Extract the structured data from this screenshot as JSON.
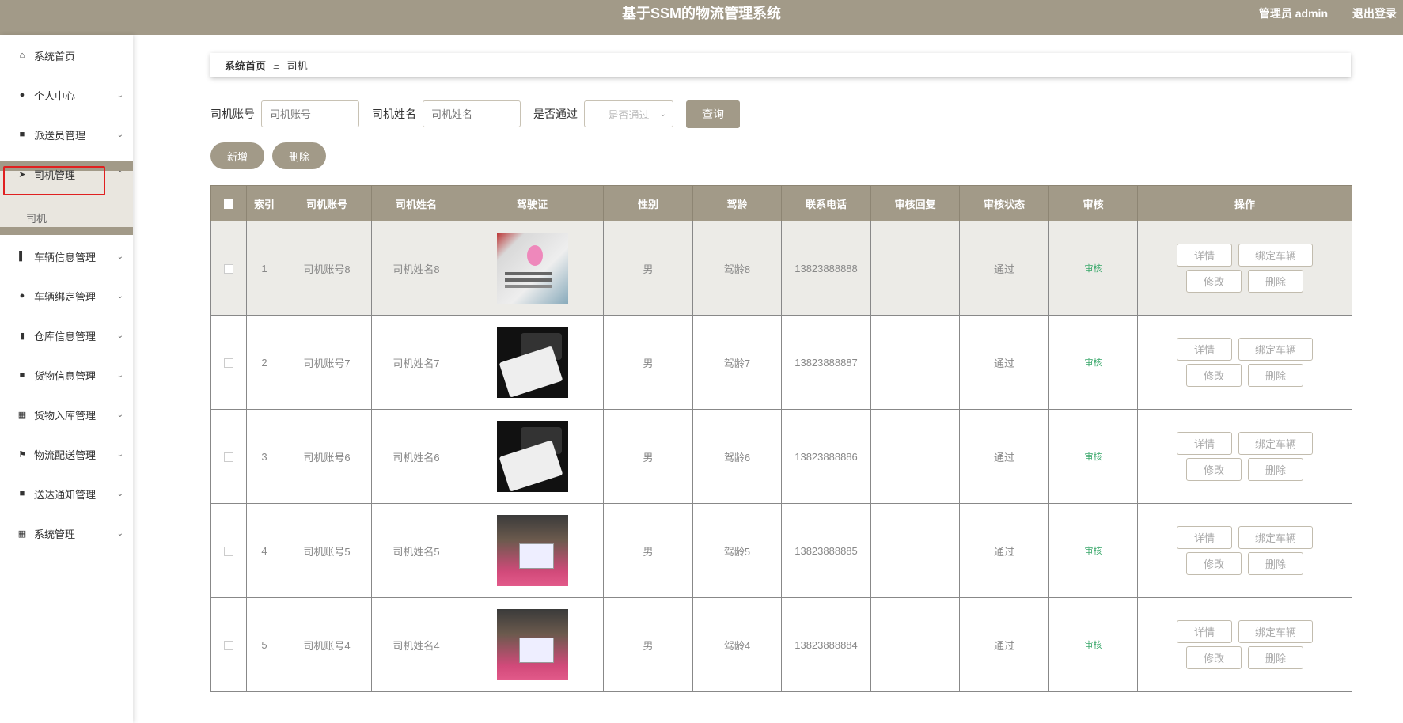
{
  "header": {
    "title": "基于SSM的物流管理系统",
    "user": "管理员 admin",
    "logout": "退出登录"
  },
  "sidebar": {
    "items": [
      {
        "label": "系统首页",
        "icon": "home-icon",
        "glyph": "⌂",
        "chevron": ""
      },
      {
        "label": "个人中心",
        "icon": "user-icon",
        "glyph": "●",
        "chevron": "⌄"
      },
      {
        "label": "派送员管理",
        "icon": "briefcase-icon",
        "glyph": "■",
        "chevron": "⌄"
      },
      {
        "label": "司机管理",
        "icon": "send-icon",
        "glyph": "➤",
        "chevron": "⌃"
      },
      {
        "label": "车辆信息管理",
        "icon": "chart-icon",
        "glyph": "▌",
        "chevron": "⌄"
      },
      {
        "label": "车辆绑定管理",
        "icon": "bulb-icon",
        "glyph": "●",
        "chevron": "⌄"
      },
      {
        "label": "仓库信息管理",
        "icon": "bar-chart-icon",
        "glyph": "▮",
        "chevron": "⌄"
      },
      {
        "label": "货物信息管理",
        "icon": "trash-icon",
        "glyph": "■",
        "chevron": "⌄"
      },
      {
        "label": "货物入库管理",
        "icon": "grid-icon",
        "glyph": "▦",
        "chevron": "⌄"
      },
      {
        "label": "物流配送管理",
        "icon": "flag-icon",
        "glyph": "⚑",
        "chevron": "⌄"
      },
      {
        "label": "送达通知管理",
        "icon": "clipboard-icon",
        "glyph": "■",
        "chevron": "⌄"
      },
      {
        "label": "系统管理",
        "icon": "grid-icon",
        "glyph": "▦",
        "chevron": "⌄"
      }
    ],
    "submenu": "司机"
  },
  "breadcrumb": {
    "home": "系统首页",
    "sep": "Ξ",
    "current": "司机"
  },
  "search": {
    "account_label": "司机账号",
    "account_placeholder": "司机账号",
    "name_label": "司机姓名",
    "name_placeholder": "司机姓名",
    "pass_label": "是否通过",
    "pass_placeholder": "是否通过",
    "query": "查询"
  },
  "actions": {
    "add": "新增",
    "delete": "删除"
  },
  "table": {
    "headers": [
      "索引",
      "司机账号",
      "司机姓名",
      "驾驶证",
      "性别",
      "驾龄",
      "联系电话",
      "审核回复",
      "审核状态",
      "审核",
      "操作"
    ],
    "rows": [
      {
        "index": "1",
        "account": "司机账号8",
        "name": "司机姓名8",
        "photo": "license-photo",
        "gender": "男",
        "years": "驾龄8",
        "phone": "13823888888",
        "reply": "",
        "status": "通过",
        "audit": "审核"
      },
      {
        "index": "2",
        "account": "司机账号7",
        "name": "司机姓名7",
        "photo": "license-photo",
        "gender": "男",
        "years": "驾龄7",
        "phone": "13823888887",
        "reply": "",
        "status": "通过",
        "audit": "审核"
      },
      {
        "index": "3",
        "account": "司机账号6",
        "name": "司机姓名6",
        "photo": "license-photo",
        "gender": "男",
        "years": "驾龄6",
        "phone": "13823888886",
        "reply": "",
        "status": "通过",
        "audit": "审核"
      },
      {
        "index": "4",
        "account": "司机账号5",
        "name": "司机姓名5",
        "photo": "license-photo",
        "gender": "男",
        "years": "驾龄5",
        "phone": "13823888885",
        "reply": "",
        "status": "通过",
        "audit": "审核"
      },
      {
        "index": "5",
        "account": "司机账号4",
        "name": "司机姓名4",
        "photo": "license-photo",
        "gender": "男",
        "years": "驾龄4",
        "phone": "13823888884",
        "reply": "",
        "status": "通过",
        "audit": "审核"
      }
    ],
    "ops": {
      "detail": "详情",
      "bind": "绑定车辆",
      "edit": "修改",
      "remove": "删除"
    }
  },
  "colors": {
    "brand": "#a29a88",
    "audit": "#3aa86b",
    "highlight_box": "#e02020"
  }
}
